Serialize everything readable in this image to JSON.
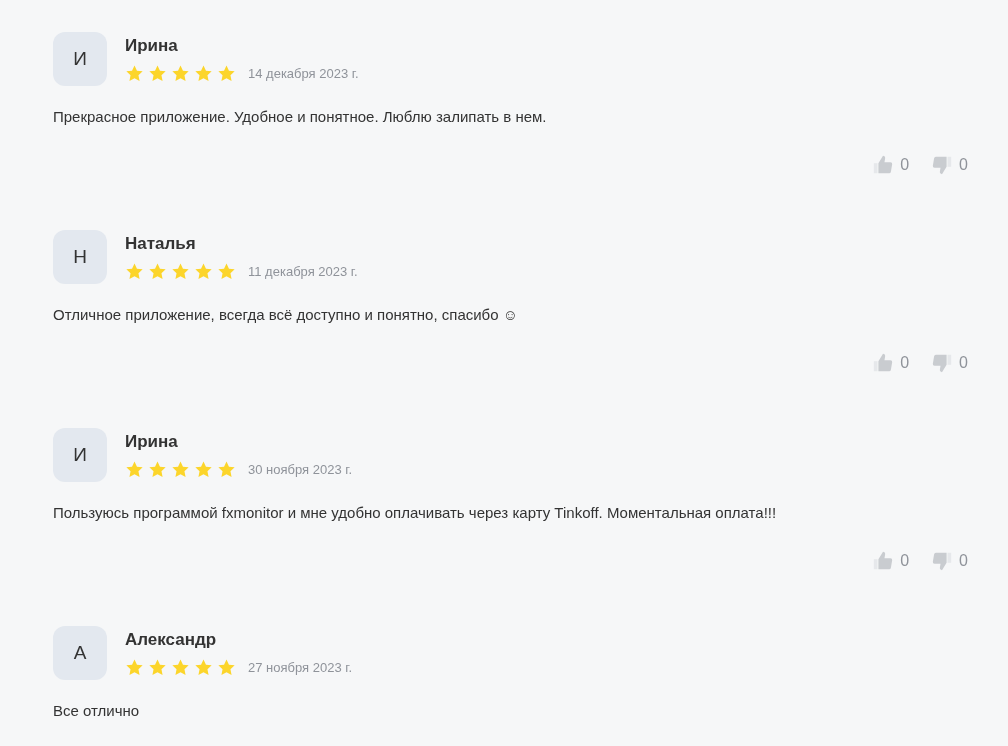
{
  "reviews": [
    {
      "initial": "И",
      "name": "Ирина",
      "stars": 5,
      "date": "14 декабря 2023 г.",
      "text": "Прекрасное приложение. Удобное и понятное. Люблю залипать в нем.",
      "likes": "0",
      "dislikes": "0"
    },
    {
      "initial": "Н",
      "name": "Наталья",
      "stars": 5,
      "date": "11 декабря 2023 г.",
      "text": "Отличное приложение, всегда всё доступно и понятно, спасибо ☺",
      "likes": "0",
      "dislikes": "0"
    },
    {
      "initial": "И",
      "name": "Ирина",
      "stars": 5,
      "date": "30 ноября 2023 г.",
      "text": "Пользуюсь программой fxmonitor и мне удобно оплачивать через карту Tinkoff. Моментальная оплата!!!",
      "likes": "0",
      "dislikes": "0"
    },
    {
      "initial": "А",
      "name": "Александр",
      "stars": 5,
      "date": "27 ноября 2023 г.",
      "text": "Все отлично"
    }
  ]
}
